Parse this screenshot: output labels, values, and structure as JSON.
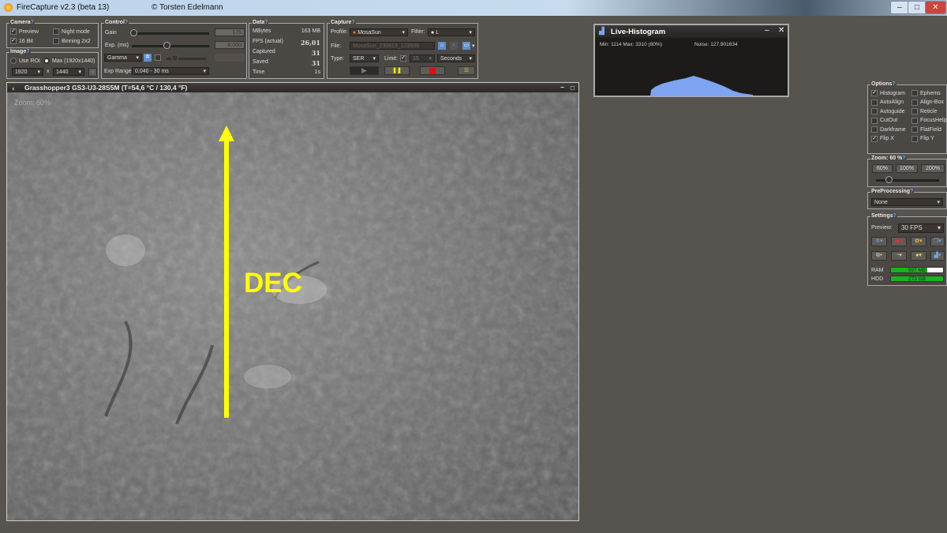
{
  "window": {
    "title": "FireCapture v2.3  (beta 13)",
    "copyright": "© Torsten Edelmann",
    "minimize": "–",
    "maximize": "□",
    "close": "✕"
  },
  "camera": {
    "title": "Camera",
    "preview": "Preview",
    "bit16": "16 Bit",
    "night": "Night mode",
    "binning": "Binning 2x2",
    "preview_checked": true,
    "bit16_checked": true
  },
  "image": {
    "title": "Image",
    "use_roi": "Use ROI",
    "max": "Max (1920x1440)",
    "width": "1920",
    "x": "x",
    "height": "1440"
  },
  "control": {
    "title": "Control",
    "gain_label": "Gain",
    "gain_value": "175",
    "gain_pos": 0.0,
    "exp_label": "Exp. (ms)",
    "exp_value": "8,000",
    "exp_pos": 0.45,
    "gamma": "Gamma",
    "exp_range_label": "Exp Range",
    "exp_range": "0.040 - 30 ms"
  },
  "data": {
    "title": "Data",
    "rows": [
      {
        "label": "MBytes",
        "value": "163 MB"
      },
      {
        "label": "FPS (actual)",
        "value": "26,01"
      },
      {
        "label": "Captured",
        "value": "31"
      },
      {
        "label": "Saved",
        "value": "31"
      },
      {
        "label": "Time",
        "value": "1s"
      }
    ]
  },
  "capture": {
    "title": "Capture",
    "profile_label": "Profile:",
    "profile": "MosaSun",
    "filter_label": "Filter:",
    "filter": "L",
    "file_label": "File:",
    "file": "MosaSun_230813_123508",
    "type_label": "Type:",
    "type": "SER",
    "limit_label": "Limit:",
    "limit": "15",
    "unit": "Seconds"
  },
  "histogram": {
    "title": "Live-Histogram",
    "stats": "Min: 1114 Max: 3310  (80%)",
    "noise": "Noise: 127.901634",
    "minimize": "–",
    "close": "✕"
  },
  "view": {
    "title": "Grasshopper3 GS3-U3-28S5M  (T=54,6 °C / 130,4 °F)",
    "zoom": "Zoom: 60%",
    "annotation": "DEC",
    "arrow_color": "#ffff00"
  },
  "options": {
    "title": "Options",
    "items": [
      {
        "label": "Histogram",
        "checked": true
      },
      {
        "label": "Ephems",
        "checked": false
      },
      {
        "label": "AutoAlign",
        "checked": false
      },
      {
        "label": "Align-Box",
        "checked": false
      },
      {
        "label": "Autoguide",
        "checked": false
      },
      {
        "label": "Reticle",
        "checked": false
      },
      {
        "label": "CutOut",
        "checked": false
      },
      {
        "label": "FocusHelp",
        "checked": false
      },
      {
        "label": "Darkframe",
        "checked": false
      },
      {
        "label": "FlatField",
        "checked": false
      },
      {
        "label": "Flip X",
        "checked": true
      },
      {
        "label": "Flip Y",
        "checked": false
      }
    ]
  },
  "zoom": {
    "title": "Zoom: 60 %",
    "b1": "60%",
    "b2": "100%",
    "b3": "200%",
    "level": 0.15
  },
  "preprocessing": {
    "title": "PreProcessing",
    "value": "None"
  },
  "settings": {
    "title": "Settings",
    "preview_label": "Preview:",
    "preview": "30 FPS",
    "ram_label": "RAM",
    "ram": "597 MB",
    "ram_fill": 0.7,
    "hdd_label": "HDD",
    "hdd": "273 GB",
    "hdd_fill": 1.0
  }
}
